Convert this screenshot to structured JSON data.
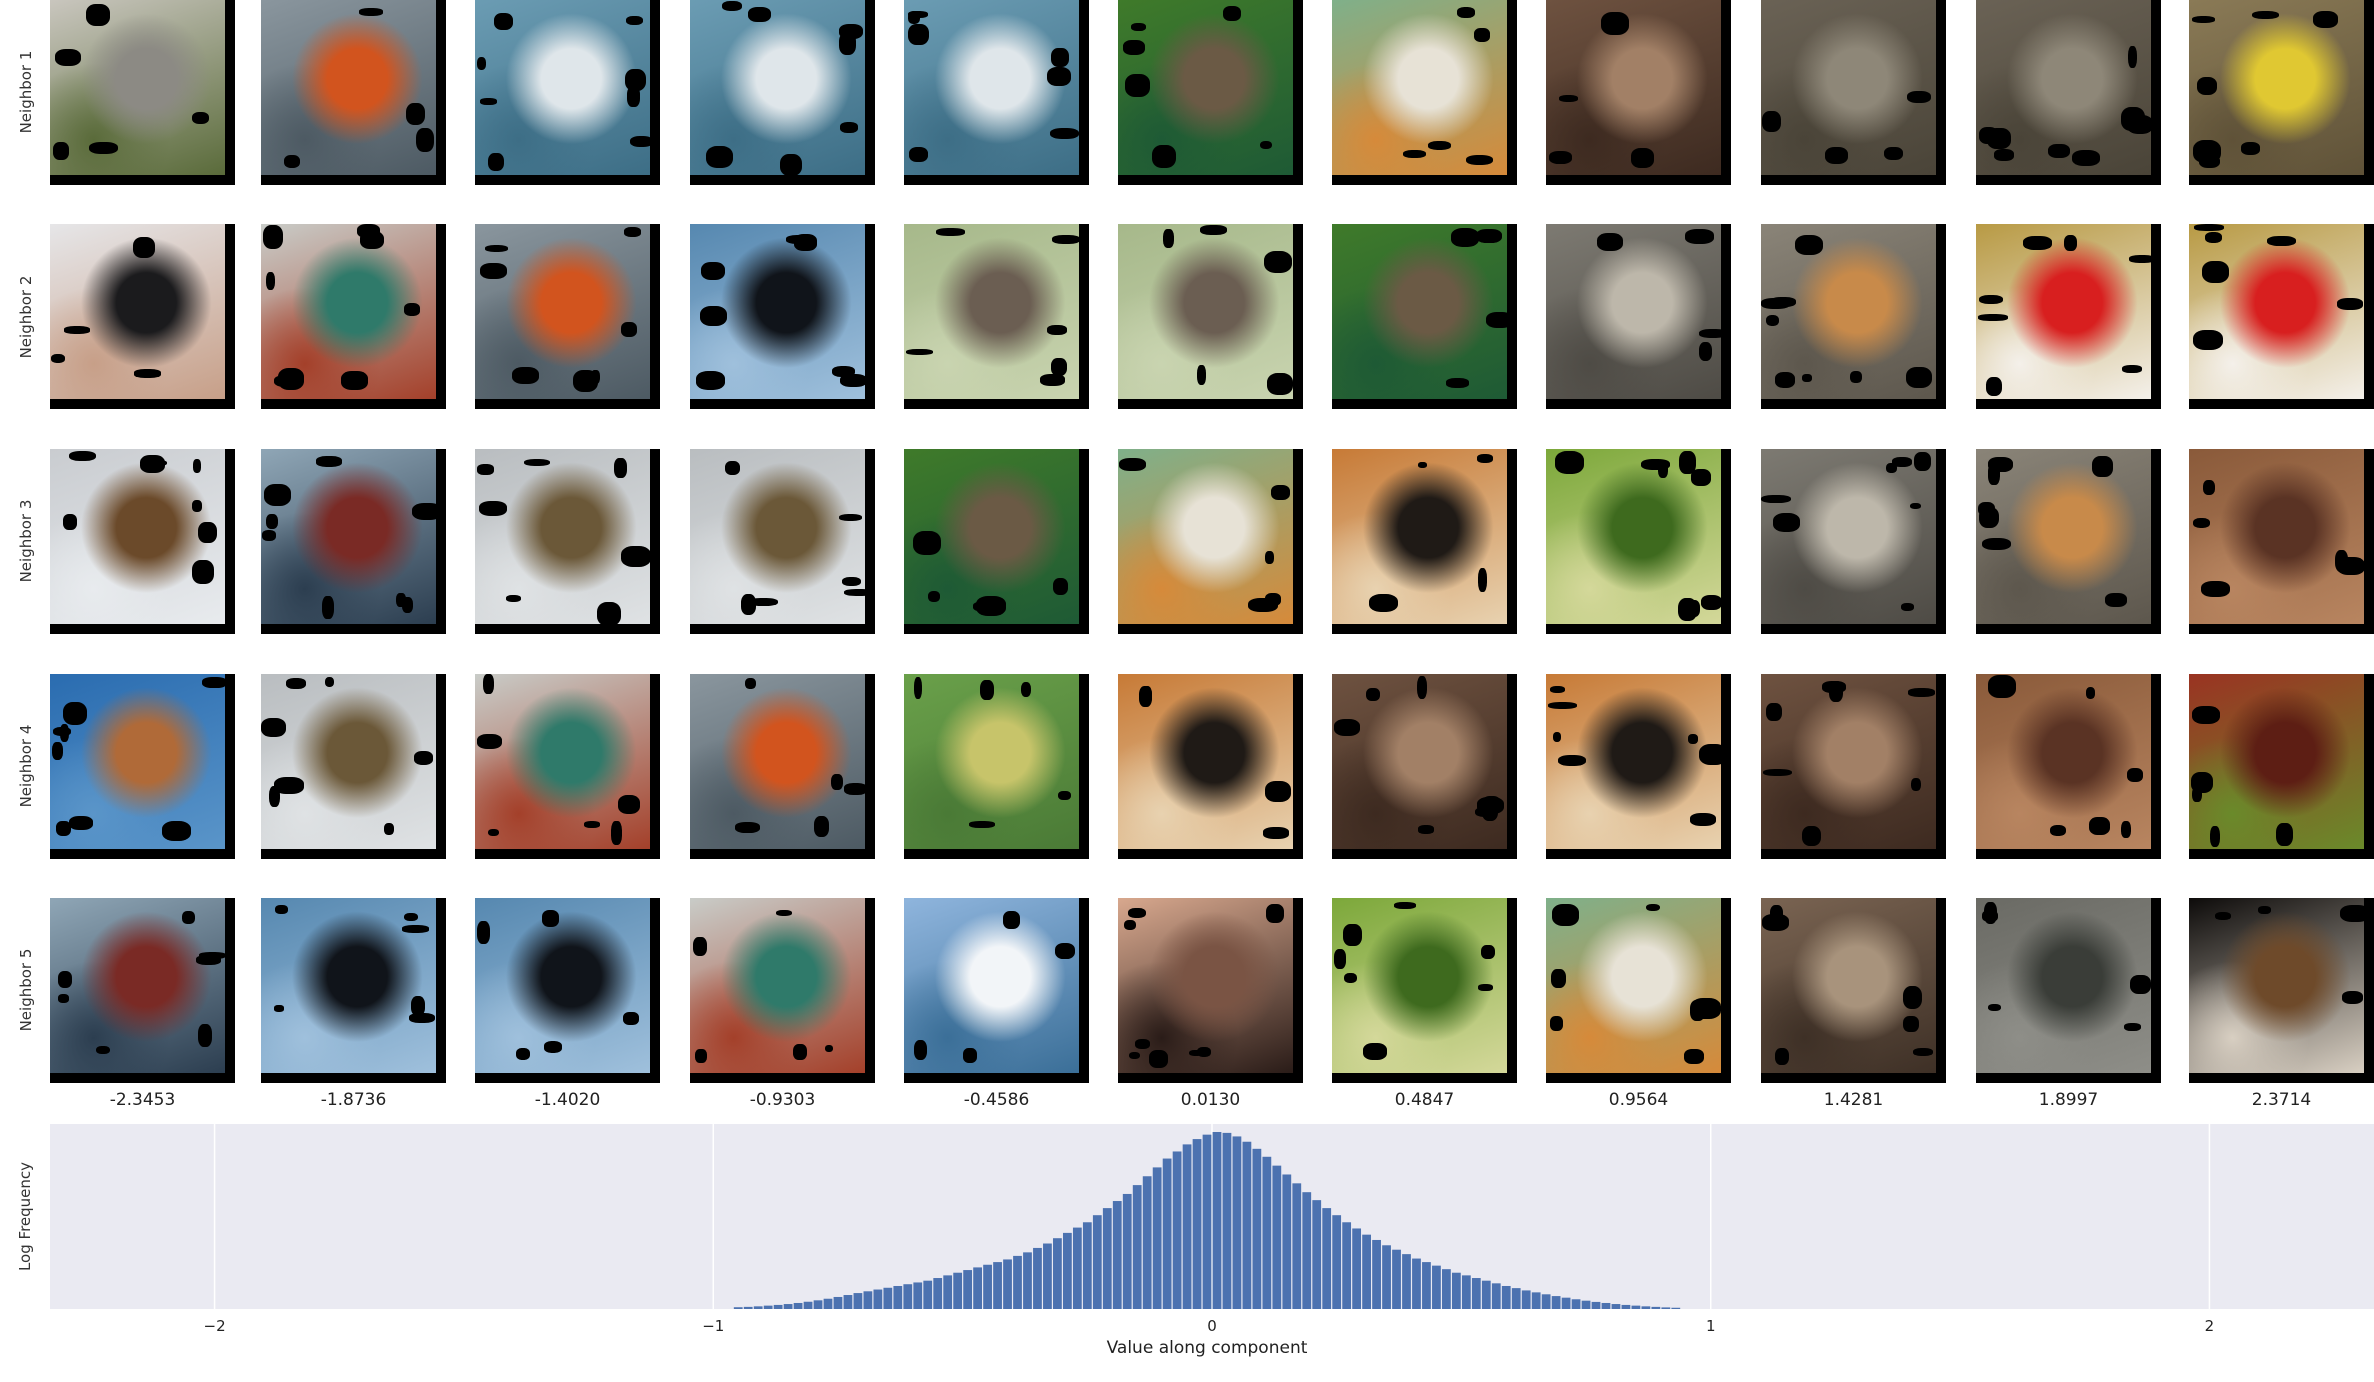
{
  "row_labels": [
    "Neighbor 1",
    "Neighbor 2",
    "Neighbor 3",
    "Neighbor 4",
    "Neighbor 5"
  ],
  "column_values": [
    "-2.3453",
    "-1.8736",
    "-1.4020",
    "-0.9303",
    "-0.4586",
    "0.0130",
    "0.4847",
    "0.9564",
    "1.4281",
    "1.8997",
    "2.3714"
  ],
  "tiles": [
    [
      "dog-white",
      "boat-orange",
      "water-blue",
      "water-blue",
      "water-blue",
      "duck-green",
      "bird-finch",
      "wood-brown",
      "snake-gray",
      "snake-gray",
      "sign-yellow"
    ],
    [
      "person-black",
      "bird-beeeater",
      "boat-orange",
      "orca-blue",
      "bird-wader",
      "bird-wader",
      "duck-green",
      "leopard-gray",
      "snake-rock",
      "jug-red",
      "jug-red"
    ],
    [
      "violin-gray",
      "ship-sail",
      "bird-ibis",
      "bird-ibis",
      "duck-green",
      "bird-finch",
      "tiger-orange",
      "lizard-green",
      "leopard-gray",
      "snake-rock",
      "wood-hook"
    ],
    [
      "dog-water",
      "bird-ibis",
      "bird-beeeater",
      "boat-orange",
      "field-green",
      "tiger-orange",
      "wood-brown",
      "tiger-orange",
      "wood-brown",
      "wood-hook",
      "brick-red"
    ],
    [
      "ship-sail",
      "orca-blue",
      "orca-blue",
      "bird-beeeater",
      "sky-blue",
      "hand-snake",
      "lizard-green",
      "bird-finch",
      "wood-scratch",
      "snake-dark",
      "dog-black"
    ]
  ],
  "tile_colors": {
    "dog-white": [
      "#c9c6be",
      "#8c8a84",
      "#5a6b3a"
    ],
    "boat-orange": [
      "#8a969e",
      "#d2541e",
      "#4d5a63"
    ],
    "water-blue": [
      "#6b9cb3",
      "#dfe6ea",
      "#3d6e86"
    ],
    "duck-green": [
      "#3f7a2a",
      "#6b5a45",
      "#1e5a35"
    ],
    "bird-finch": [
      "#7fb08a",
      "#e7e2d6",
      "#d68a3a"
    ],
    "wood-brown": [
      "#6e5240",
      "#a28066",
      "#3d2a20"
    ],
    "snake-gray": [
      "#6a6255",
      "#8e8778",
      "#4a4438"
    ],
    "sign-yellow": [
      "#8a7a56",
      "#e0c832",
      "#5f5238"
    ],
    "person-black": [
      "#e6e6e8",
      "#1b1b1d",
      "#c79f88"
    ],
    "bird-beeeater": [
      "#c9ccc8",
      "#2f7a6a",
      "#a4402a"
    ],
    "orca-blue": [
      "#5688b0",
      "#10141a",
      "#9fc0dc"
    ],
    "bird-wader": [
      "#a6b88a",
      "#6b5e52",
      "#c9d4b0"
    ],
    "leopard-gray": [
      "#7d7a72",
      "#bdb7aa",
      "#4e4b45"
    ],
    "snake-rock": [
      "#8a8478",
      "#c88a4a",
      "#5d574d"
    ],
    "jug-red": [
      "#b89a44",
      "#d81f1f",
      "#f4f0ea"
    ],
    "violin-gray": [
      "#c9ccd0",
      "#6b4a2a",
      "#e8ebee"
    ],
    "ship-sail": [
      "#8fa6b6",
      "#7a2a25",
      "#2c3e50"
    ],
    "bird-ibis": [
      "#b9bdc0",
      "#6b5838",
      "#dfe2e4"
    ],
    "tiger-orange": [
      "#c77a36",
      "#1f1a16",
      "#e8d2b0"
    ],
    "lizard-green": [
      "#7ca83a",
      "#3e6a1e",
      "#d4d89a"
    ],
    "wood-hook": [
      "#8a5a3a",
      "#5a3324",
      "#b88560"
    ],
    "dog-water": [
      "#2a6cb0",
      "#b06a38",
      "#5a95c9"
    ],
    "field-green": [
      "#6aa04a",
      "#c7c46a",
      "#4a7a36"
    ],
    "brick-red": [
      "#9a3322",
      "#5d1e14",
      "#6a8a2a"
    ],
    "sky-blue": [
      "#8fb5dd",
      "#f2f5f8",
      "#3b6f98"
    ],
    "hand-snake": [
      "#d8a88e",
      "#7a5444",
      "#2a1c18"
    ],
    "wood-scratch": [
      "#7a6452",
      "#a8937c",
      "#3e3026"
    ],
    "snake-dark": [
      "#6a6a64",
      "#3a3d38",
      "#8e8e88"
    ],
    "dog-black": [
      "#0d0b0a",
      "#6e4a2a",
      "#d8cfc2"
    ]
  },
  "chart_data": {
    "type": "bar",
    "title": "",
    "xlabel": "Value along component",
    "ylabel": "Log Frequency",
    "xlim": [
      -2.33,
      2.33
    ],
    "xticks": [
      -2,
      -1,
      0,
      1,
      2
    ],
    "xtick_labels": [
      "−2",
      "−1",
      "0",
      "1",
      "2"
    ],
    "grid": true,
    "bin_width": 0.02,
    "bins": [
      [
        -0.95,
        0.01
      ],
      [
        -0.93,
        0.012
      ],
      [
        -0.91,
        0.015
      ],
      [
        -0.89,
        0.019
      ],
      [
        -0.87,
        0.023
      ],
      [
        -0.85,
        0.028
      ],
      [
        -0.83,
        0.034
      ],
      [
        -0.81,
        0.041
      ],
      [
        -0.79,
        0.049
      ],
      [
        -0.77,
        0.058
      ],
      [
        -0.75,
        0.068
      ],
      [
        -0.73,
        0.079
      ],
      [
        -0.71,
        0.09
      ],
      [
        -0.69,
        0.1
      ],
      [
        -0.67,
        0.11
      ],
      [
        -0.65,
        0.12
      ],
      [
        -0.63,
        0.13
      ],
      [
        -0.61,
        0.14
      ],
      [
        -0.59,
        0.15
      ],
      [
        -0.57,
        0.16
      ],
      [
        -0.55,
        0.175
      ],
      [
        -0.53,
        0.19
      ],
      [
        -0.51,
        0.205
      ],
      [
        -0.49,
        0.22
      ],
      [
        -0.47,
        0.235
      ],
      [
        -0.45,
        0.25
      ],
      [
        -0.43,
        0.265
      ],
      [
        -0.41,
        0.28
      ],
      [
        -0.39,
        0.3
      ],
      [
        -0.37,
        0.32
      ],
      [
        -0.35,
        0.345
      ],
      [
        -0.33,
        0.37
      ],
      [
        -0.31,
        0.4
      ],
      [
        -0.29,
        0.43
      ],
      [
        -0.27,
        0.46
      ],
      [
        -0.25,
        0.49
      ],
      [
        -0.23,
        0.53
      ],
      [
        -0.21,
        0.57
      ],
      [
        -0.19,
        0.61
      ],
      [
        -0.17,
        0.65
      ],
      [
        -0.15,
        0.7
      ],
      [
        -0.13,
        0.75
      ],
      [
        -0.11,
        0.8
      ],
      [
        -0.09,
        0.85
      ],
      [
        -0.07,
        0.89
      ],
      [
        -0.05,
        0.93
      ],
      [
        -0.03,
        0.96
      ],
      [
        -0.01,
        0.985
      ],
      [
        0.01,
        1.0
      ],
      [
        0.03,
        0.995
      ],
      [
        0.05,
        0.975
      ],
      [
        0.07,
        0.945
      ],
      [
        0.09,
        0.905
      ],
      [
        0.11,
        0.86
      ],
      [
        0.13,
        0.81
      ],
      [
        0.15,
        0.76
      ],
      [
        0.17,
        0.71
      ],
      [
        0.19,
        0.66
      ],
      [
        0.21,
        0.615
      ],
      [
        0.23,
        0.57
      ],
      [
        0.25,
        0.53
      ],
      [
        0.27,
        0.49
      ],
      [
        0.29,
        0.455
      ],
      [
        0.31,
        0.42
      ],
      [
        0.33,
        0.39
      ],
      [
        0.35,
        0.36
      ],
      [
        0.37,
        0.335
      ],
      [
        0.39,
        0.31
      ],
      [
        0.41,
        0.285
      ],
      [
        0.43,
        0.265
      ],
      [
        0.45,
        0.245
      ],
      [
        0.47,
        0.225
      ],
      [
        0.49,
        0.205
      ],
      [
        0.51,
        0.19
      ],
      [
        0.53,
        0.175
      ],
      [
        0.55,
        0.16
      ],
      [
        0.57,
        0.145
      ],
      [
        0.59,
        0.13
      ],
      [
        0.61,
        0.118
      ],
      [
        0.63,
        0.105
      ],
      [
        0.65,
        0.094
      ],
      [
        0.67,
        0.083
      ],
      [
        0.69,
        0.073
      ],
      [
        0.71,
        0.064
      ],
      [
        0.73,
        0.055
      ],
      [
        0.75,
        0.047
      ],
      [
        0.77,
        0.04
      ],
      [
        0.79,
        0.034
      ],
      [
        0.81,
        0.028
      ],
      [
        0.83,
        0.023
      ],
      [
        0.85,
        0.019
      ],
      [
        0.87,
        0.015
      ],
      [
        0.89,
        0.012
      ],
      [
        0.91,
        0.009
      ],
      [
        0.93,
        0.007
      ]
    ],
    "bar_color": "#4c72b0",
    "background_color": "#eaeaf2",
    "grid_color": "#ffffff"
  }
}
